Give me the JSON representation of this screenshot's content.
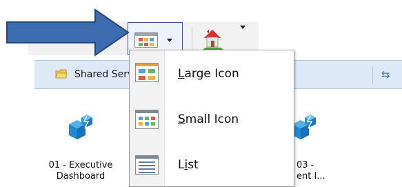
{
  "toolbar": {
    "view_button_icon": "view-options-icon",
    "view_dropdown_icon": "chevron-down-icon",
    "home_button_icon": "home-icon",
    "home_dropdown_icon": "chevron-down-icon",
    "faded_glyph": "✕"
  },
  "callout": {
    "icon": "blue-arrow-pointer-icon",
    "color": "#3c6bb0"
  },
  "address_bar": {
    "folder_icon": "folder-icon",
    "label": "Shared Services",
    "refresh_icon": "refresh-icon",
    "refresh_glyph": "⇆"
  },
  "tiles": [
    {
      "line1": "01 - Executive",
      "line2": "Dashboard",
      "icon": "dashboard-cube-icon"
    },
    {
      "line1": "03 -",
      "line2": "ent I...",
      "icon": "dashboard-cube-icon"
    }
  ],
  "view_menu": {
    "items": [
      {
        "icon": "large-icon-view-icon",
        "accelerator": "L",
        "rest": "arge Icon"
      },
      {
        "icon": "small-icon-view-icon",
        "accelerator": "S",
        "rest": "mall Icon"
      },
      {
        "icon": "list-view-icon",
        "prefix": "L",
        "accelerator": "i",
        "rest": "st"
      }
    ]
  },
  "colors": {
    "accent_border": "#3b4fb0",
    "address_bg": "#dde9f7",
    "cube_blue": "#1d8ad8"
  }
}
